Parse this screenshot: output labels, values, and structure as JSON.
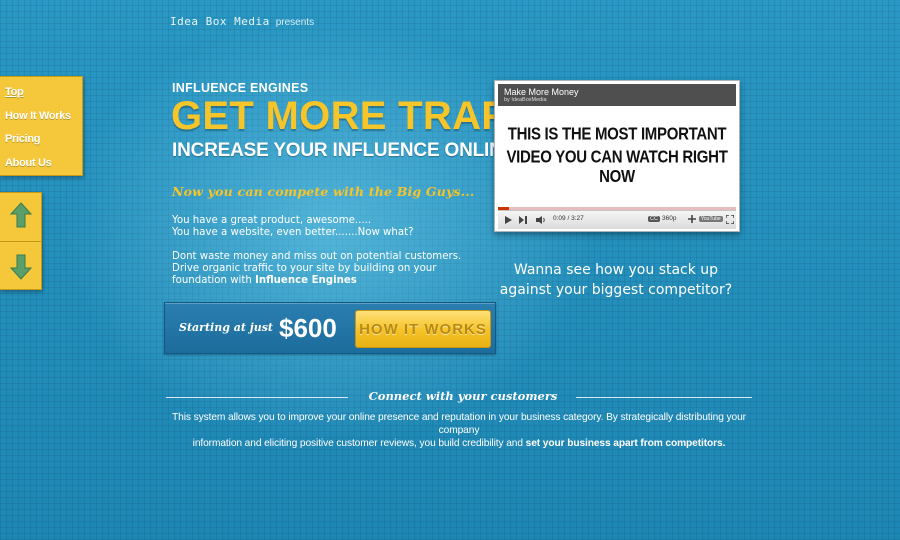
{
  "header": {
    "brand": "Idea Box Media",
    "presents": "presents"
  },
  "side_nav": {
    "items": [
      "Top",
      "How It Works",
      "Pricing",
      "About Us"
    ]
  },
  "hero": {
    "eyebrow": "INFLUENCE ENGINES",
    "headline": "GET MORE TRAFFIC",
    "subheadline": "INCREASE YOUR INFLUENCE ONLINE",
    "tagline": "Now you can compete with the Big Guys...",
    "p1_line1": "You  have  a great product, awesome.....",
    "p1_line2": "You have a website, even better.......Now what?",
    "p2_line1": "Dont waste money and miss out on potential customers.",
    "p2_line2": "Drive organic traffic to your site by building on your",
    "p2_line3_pre": "foundation with ",
    "p2_line3_bold": "Influence Engines"
  },
  "pricing": {
    "starting_label": "Starting at just",
    "price": "$600",
    "cta_label": "HOW IT WORKS"
  },
  "video": {
    "title": "Make More Money",
    "channel": "by IdeaBoxMedia",
    "screen_line1": "THIS IS THE MOST IMPORTANT",
    "screen_line2": "VIDEO YOU CAN WATCH RIGHT NOW",
    "time": "0:09 / 3:27",
    "quality": "360p",
    "cc_label": "CC",
    "youtube_label": "YouTube",
    "progress": 0.045
  },
  "competitor": {
    "line1": "Wanna see how you stack up",
    "line2": "against your biggest competitor?"
  },
  "connect": {
    "title": "Connect with your customers",
    "line1": "This system allows you to improve your online presence and reputation in your business category.  By strategically distributing your company",
    "line2_pre": "information and eliciting positive customer reviews, you build credibility and ",
    "line2_bold": "set your business apart from competitors."
  },
  "colors": {
    "background": "#1f87b5",
    "accent_yellow": "#f6c52a",
    "nav_yellow": "#f4c83a",
    "arrow_green": "#5a9e6a"
  }
}
